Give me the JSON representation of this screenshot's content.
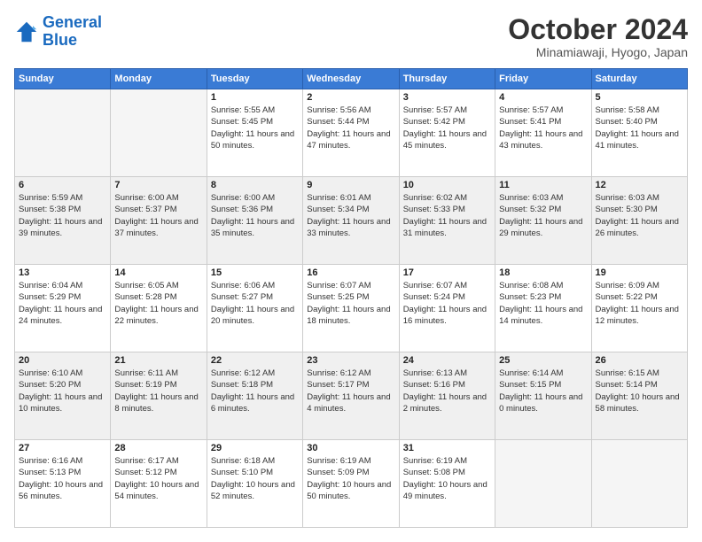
{
  "header": {
    "logo_line1": "General",
    "logo_line2": "Blue",
    "month": "October 2024",
    "location": "Minamiawaji, Hyogo, Japan"
  },
  "days_of_week": [
    "Sunday",
    "Monday",
    "Tuesday",
    "Wednesday",
    "Thursday",
    "Friday",
    "Saturday"
  ],
  "weeks": [
    [
      {
        "day": "",
        "sunrise": "",
        "sunset": "",
        "daylight": "",
        "empty": true
      },
      {
        "day": "",
        "sunrise": "",
        "sunset": "",
        "daylight": "",
        "empty": true
      },
      {
        "day": "1",
        "sunrise": "Sunrise: 5:55 AM",
        "sunset": "Sunset: 5:45 PM",
        "daylight": "Daylight: 11 hours and 50 minutes."
      },
      {
        "day": "2",
        "sunrise": "Sunrise: 5:56 AM",
        "sunset": "Sunset: 5:44 PM",
        "daylight": "Daylight: 11 hours and 47 minutes."
      },
      {
        "day": "3",
        "sunrise": "Sunrise: 5:57 AM",
        "sunset": "Sunset: 5:42 PM",
        "daylight": "Daylight: 11 hours and 45 minutes."
      },
      {
        "day": "4",
        "sunrise": "Sunrise: 5:57 AM",
        "sunset": "Sunset: 5:41 PM",
        "daylight": "Daylight: 11 hours and 43 minutes."
      },
      {
        "day": "5",
        "sunrise": "Sunrise: 5:58 AM",
        "sunset": "Sunset: 5:40 PM",
        "daylight": "Daylight: 11 hours and 41 minutes."
      }
    ],
    [
      {
        "day": "6",
        "sunrise": "Sunrise: 5:59 AM",
        "sunset": "Sunset: 5:38 PM",
        "daylight": "Daylight: 11 hours and 39 minutes."
      },
      {
        "day": "7",
        "sunrise": "Sunrise: 6:00 AM",
        "sunset": "Sunset: 5:37 PM",
        "daylight": "Daylight: 11 hours and 37 minutes."
      },
      {
        "day": "8",
        "sunrise": "Sunrise: 6:00 AM",
        "sunset": "Sunset: 5:36 PM",
        "daylight": "Daylight: 11 hours and 35 minutes."
      },
      {
        "day": "9",
        "sunrise": "Sunrise: 6:01 AM",
        "sunset": "Sunset: 5:34 PM",
        "daylight": "Daylight: 11 hours and 33 minutes."
      },
      {
        "day": "10",
        "sunrise": "Sunrise: 6:02 AM",
        "sunset": "Sunset: 5:33 PM",
        "daylight": "Daylight: 11 hours and 31 minutes."
      },
      {
        "day": "11",
        "sunrise": "Sunrise: 6:03 AM",
        "sunset": "Sunset: 5:32 PM",
        "daylight": "Daylight: 11 hours and 29 minutes."
      },
      {
        "day": "12",
        "sunrise": "Sunrise: 6:03 AM",
        "sunset": "Sunset: 5:30 PM",
        "daylight": "Daylight: 11 hours and 26 minutes."
      }
    ],
    [
      {
        "day": "13",
        "sunrise": "Sunrise: 6:04 AM",
        "sunset": "Sunset: 5:29 PM",
        "daylight": "Daylight: 11 hours and 24 minutes."
      },
      {
        "day": "14",
        "sunrise": "Sunrise: 6:05 AM",
        "sunset": "Sunset: 5:28 PM",
        "daylight": "Daylight: 11 hours and 22 minutes."
      },
      {
        "day": "15",
        "sunrise": "Sunrise: 6:06 AM",
        "sunset": "Sunset: 5:27 PM",
        "daylight": "Daylight: 11 hours and 20 minutes."
      },
      {
        "day": "16",
        "sunrise": "Sunrise: 6:07 AM",
        "sunset": "Sunset: 5:25 PM",
        "daylight": "Daylight: 11 hours and 18 minutes."
      },
      {
        "day": "17",
        "sunrise": "Sunrise: 6:07 AM",
        "sunset": "Sunset: 5:24 PM",
        "daylight": "Daylight: 11 hours and 16 minutes."
      },
      {
        "day": "18",
        "sunrise": "Sunrise: 6:08 AM",
        "sunset": "Sunset: 5:23 PM",
        "daylight": "Daylight: 11 hours and 14 minutes."
      },
      {
        "day": "19",
        "sunrise": "Sunrise: 6:09 AM",
        "sunset": "Sunset: 5:22 PM",
        "daylight": "Daylight: 11 hours and 12 minutes."
      }
    ],
    [
      {
        "day": "20",
        "sunrise": "Sunrise: 6:10 AM",
        "sunset": "Sunset: 5:20 PM",
        "daylight": "Daylight: 11 hours and 10 minutes."
      },
      {
        "day": "21",
        "sunrise": "Sunrise: 6:11 AM",
        "sunset": "Sunset: 5:19 PM",
        "daylight": "Daylight: 11 hours and 8 minutes."
      },
      {
        "day": "22",
        "sunrise": "Sunrise: 6:12 AM",
        "sunset": "Sunset: 5:18 PM",
        "daylight": "Daylight: 11 hours and 6 minutes."
      },
      {
        "day": "23",
        "sunrise": "Sunrise: 6:12 AM",
        "sunset": "Sunset: 5:17 PM",
        "daylight": "Daylight: 11 hours and 4 minutes."
      },
      {
        "day": "24",
        "sunrise": "Sunrise: 6:13 AM",
        "sunset": "Sunset: 5:16 PM",
        "daylight": "Daylight: 11 hours and 2 minutes."
      },
      {
        "day": "25",
        "sunrise": "Sunrise: 6:14 AM",
        "sunset": "Sunset: 5:15 PM",
        "daylight": "Daylight: 11 hours and 0 minutes."
      },
      {
        "day": "26",
        "sunrise": "Sunrise: 6:15 AM",
        "sunset": "Sunset: 5:14 PM",
        "daylight": "Daylight: 10 hours and 58 minutes."
      }
    ],
    [
      {
        "day": "27",
        "sunrise": "Sunrise: 6:16 AM",
        "sunset": "Sunset: 5:13 PM",
        "daylight": "Daylight: 10 hours and 56 minutes."
      },
      {
        "day": "28",
        "sunrise": "Sunrise: 6:17 AM",
        "sunset": "Sunset: 5:12 PM",
        "daylight": "Daylight: 10 hours and 54 minutes."
      },
      {
        "day": "29",
        "sunrise": "Sunrise: 6:18 AM",
        "sunset": "Sunset: 5:10 PM",
        "daylight": "Daylight: 10 hours and 52 minutes."
      },
      {
        "day": "30",
        "sunrise": "Sunrise: 6:19 AM",
        "sunset": "Sunset: 5:09 PM",
        "daylight": "Daylight: 10 hours and 50 minutes."
      },
      {
        "day": "31",
        "sunrise": "Sunrise: 6:19 AM",
        "sunset": "Sunset: 5:08 PM",
        "daylight": "Daylight: 10 hours and 49 minutes."
      },
      {
        "day": "",
        "sunrise": "",
        "sunset": "",
        "daylight": "",
        "empty": true
      },
      {
        "day": "",
        "sunrise": "",
        "sunset": "",
        "daylight": "",
        "empty": true
      }
    ]
  ]
}
